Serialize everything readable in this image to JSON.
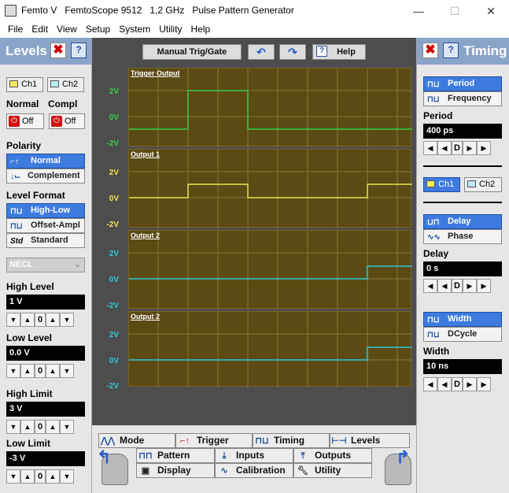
{
  "window": {
    "title": "Femto V   FemtoScope 9512   1,2 GHz   Pulse Pattern Generator",
    "minimize": "—",
    "maximize": "☐",
    "close": "✕"
  },
  "menu": [
    "File",
    "Edit",
    "View",
    "Setup",
    "System",
    "Utility",
    "Help"
  ],
  "left": {
    "title": "Levels",
    "ch1": "Ch1",
    "ch2": "Ch2",
    "normal_label": "Normal",
    "compl_label": "Compl",
    "off1": "Off",
    "off2": "Off",
    "polarity_label": "Polarity",
    "polarity_normal": "Normal",
    "polarity_complement": "Complement",
    "level_format_label": "Level Format",
    "format_high_low": "High-Low",
    "format_offset_ampl": "Offset-Ampl",
    "format_standard": "Standard",
    "std_tag": "Std",
    "logic_family": "NECL",
    "high_level_label": "High Level",
    "high_level_value": "1 V",
    "low_level_label": "Low Level",
    "low_level_value": "0.0 V",
    "high_limit_label": "High Limit",
    "high_limit_value": "3 V",
    "low_limit_label": "Low Limit",
    "low_limit_value": "-3 V",
    "stepper_digit": "0"
  },
  "right": {
    "title": "Timing",
    "period_btn": "Period",
    "frequency_btn": "Frequency",
    "period_label": "Period",
    "period_value": "400 ps",
    "ch1": "Ch1",
    "ch2": "Ch2",
    "delay_btn": "Delay",
    "phase_btn": "Phase",
    "delay_label": "Delay",
    "delay_value": "0 s",
    "width_btn": "Width",
    "dcycle_btn": "DCycle",
    "width_label": "Width",
    "width_value": "10 ns",
    "stepper_d": "D"
  },
  "toolbar": {
    "manual_trig": "Manual Trig/Gate",
    "help": "Help",
    "undo_icon": "undo-icon",
    "redo_icon": "redo-icon"
  },
  "traces": [
    {
      "name": "Trigger Output",
      "y_labels": [
        "2V",
        "0V",
        "-2V"
      ],
      "color": "#35d04a"
    },
    {
      "name": "Output 1",
      "y_labels": [
        "2V",
        "0V",
        "-2V"
      ],
      "color": "#f0e050"
    },
    {
      "name": "Output 2",
      "y_labels": [
        "2V",
        "0V",
        "-2V"
      ],
      "color": "#30c8d8"
    },
    {
      "name": "Output 2",
      "y_labels": [
        "2V",
        "0V",
        "-2V"
      ],
      "color": "#30c8d8"
    }
  ],
  "nav": {
    "mode": "Mode",
    "trigger": "Trigger",
    "timing": "Timing",
    "levels": "Levels",
    "pattern": "Pattern",
    "inputs": "Inputs",
    "outputs": "Outputs",
    "display": "Display",
    "calibration": "Calibration",
    "utility": "Utility"
  }
}
